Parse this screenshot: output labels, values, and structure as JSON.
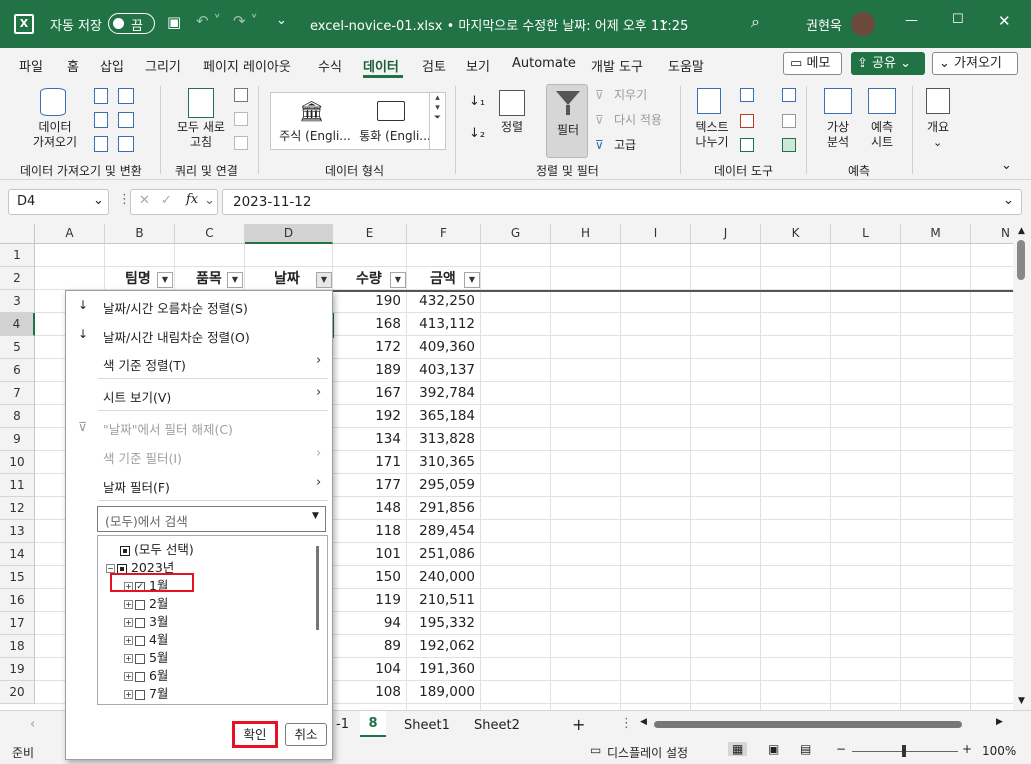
{
  "titlebar": {
    "autosave_label": "자동 저장",
    "toggle_state": "끔",
    "file_title": "excel-novice-01.xlsx • 마지막으로 수정한 날짜: 어제 오후 11:25",
    "user": "권현욱"
  },
  "menubar": {
    "tabs": [
      "파일",
      "홈",
      "삽입",
      "그리기",
      "페이지 레이아웃",
      "수식",
      "데이터",
      "검토",
      "보기",
      "Automate",
      "개발 도구",
      "도움말"
    ],
    "active": "데이터",
    "memo": "메모",
    "share": "공유",
    "fetch": "가져오기"
  },
  "ribbon": {
    "get_data": "데이터\n가져오기",
    "group1": "데이터 가져오기 및 변환",
    "refresh_all": "모두 새로\n고침",
    "group2": "쿼리 및 연결",
    "stocks": "주식 (Engli...",
    "currency": "통화 (Engli...",
    "group3": "데이터 형식",
    "sort": "정렬",
    "filter": "필터",
    "clear": "지우기",
    "reapply": "다시 적용",
    "advanced": "고급",
    "group4": "정렬 및 필터",
    "text_to_columns": "텍스트\n나누기",
    "group5": "데이터 도구",
    "what_if": "가상\n분석",
    "forecast_sheet": "예측\n시트",
    "group6": "예측",
    "outline": "개요"
  },
  "formula_bar": {
    "name_box": "D4",
    "fx": "fx",
    "value": "2023-11-12"
  },
  "columns": [
    "A",
    "B",
    "C",
    "D",
    "E",
    "F",
    "G",
    "H",
    "I",
    "J",
    "K",
    "L",
    "M",
    "N"
  ],
  "rows": [
    "1",
    "2",
    "3",
    "4",
    "5",
    "6",
    "7",
    "8",
    "9",
    "10",
    "11",
    "12",
    "13",
    "14",
    "15",
    "16",
    "17",
    "18",
    "19",
    "20"
  ],
  "table": {
    "headers": [
      "팀명",
      "품목",
      "날짜",
      "수량",
      "금액"
    ],
    "qty": [
      "190",
      "168",
      "172",
      "189",
      "167",
      "192",
      "134",
      "171",
      "177",
      "148",
      "118",
      "101",
      "150",
      "119",
      "94",
      "89",
      "104",
      "108"
    ],
    "amount": [
      "432,250",
      "413,112",
      "409,360",
      "403,137",
      "392,784",
      "365,184",
      "313,828",
      "310,365",
      "295,059",
      "291,856",
      "289,454",
      "251,086",
      "240,000",
      "210,511",
      "195,332",
      "192,062",
      "191,360",
      "189,000"
    ]
  },
  "dropdown": {
    "sort_asc": "날짜/시간 오름차순 정렬(S)",
    "sort_desc": "날짜/시간 내림차순 정렬(O)",
    "sort_color": "색 기준 정렬(T)",
    "sheet_view": "시트 보기(V)",
    "clear_filter": "\"날짜\"에서 필터 해제(C)",
    "color_filter": "색 기준 필터(I)",
    "date_filter": "날짜 필터(F)",
    "search_placeholder": "(모두)에서 검색",
    "tree": [
      "(모두 선택)",
      "2023년",
      "1월",
      "2월",
      "3월",
      "4월",
      "5월",
      "6월",
      "7월"
    ],
    "ok": "확인",
    "cancel": "취소"
  },
  "sheet_tabs": {
    "partial1": "-1",
    "partial2": "8",
    "sheet1": "Sheet1",
    "sheet2": "Sheet2",
    "add": "+"
  },
  "status": {
    "ready": "준비",
    "display_settings": "디스플레이 설정",
    "zoom": "100%"
  },
  "colors": {
    "excel_green": "#217346",
    "highlight_red": "#e81123"
  }
}
